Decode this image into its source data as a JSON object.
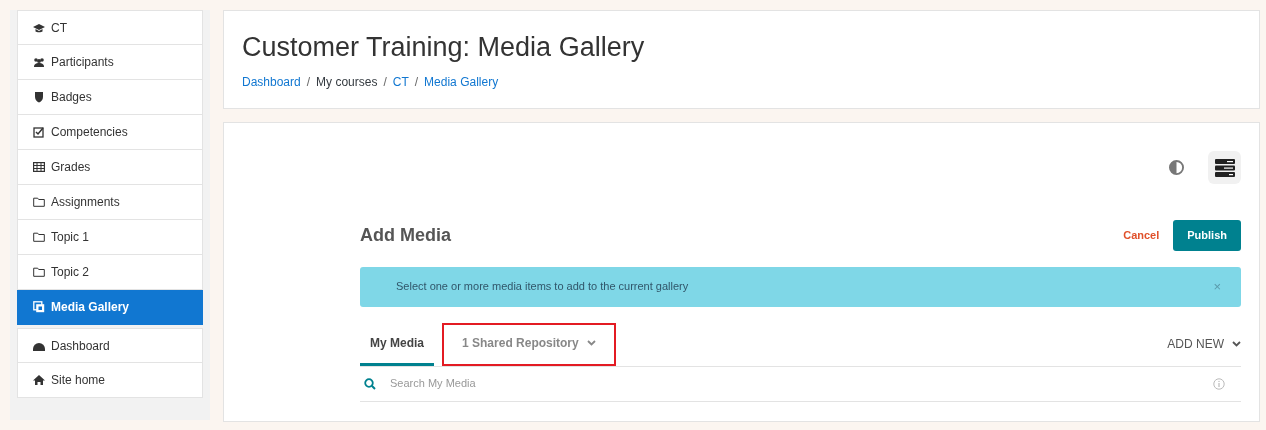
{
  "sidebar": {
    "items": [
      {
        "label": "CT",
        "selected": false
      },
      {
        "label": "Participants",
        "selected": false
      },
      {
        "label": "Badges",
        "selected": false
      },
      {
        "label": "Competencies",
        "selected": false
      },
      {
        "label": "Grades",
        "selected": false
      },
      {
        "label": "Assignments",
        "selected": false
      },
      {
        "label": "Topic 1",
        "selected": false
      },
      {
        "label": "Topic 2",
        "selected": false
      },
      {
        "label": "Media Gallery",
        "selected": true
      }
    ],
    "items2": [
      {
        "label": "Dashboard",
        "selected": false
      },
      {
        "label": "Site home",
        "selected": false
      }
    ]
  },
  "header": {
    "title": "Customer Training: Media Gallery",
    "breadcrumb": [
      {
        "label": "Dashboard",
        "link": true
      },
      {
        "label": "My courses",
        "link": false
      },
      {
        "label": "CT",
        "link": true
      },
      {
        "label": "Media Gallery",
        "link": true
      }
    ],
    "separators": [
      "/",
      "/",
      "/"
    ]
  },
  "add_media": {
    "title": "Add Media",
    "cancel": "Cancel",
    "publish": "Publish",
    "alert": "Select one or more media items to add to the current gallery",
    "alert_close": "×",
    "tabs": [
      {
        "label": "My Media",
        "selected": true,
        "dropdown": false,
        "highlighted": false
      },
      {
        "label": "1 Shared Repository",
        "selected": false,
        "dropdown": true,
        "highlighted": true
      }
    ],
    "add_new": "ADD NEW",
    "search": {
      "placeholder": "Search My Media"
    }
  }
}
